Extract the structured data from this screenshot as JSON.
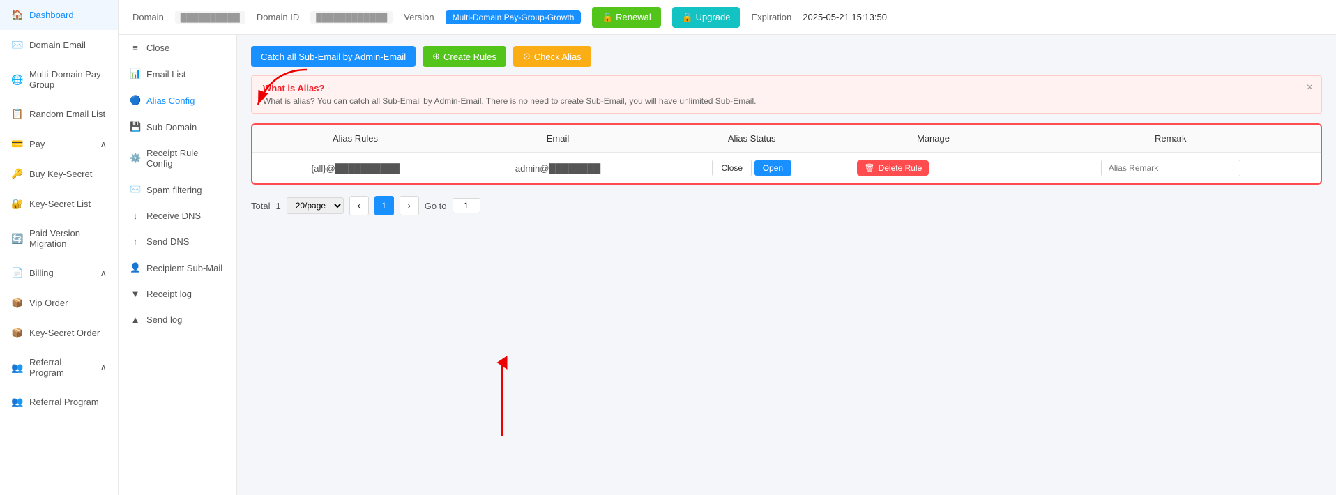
{
  "sidebar": {
    "items": [
      {
        "id": "dashboard",
        "label": "Dashboard",
        "icon": "🏠"
      },
      {
        "id": "domain-email",
        "label": "Domain Email",
        "icon": "✉️"
      },
      {
        "id": "multi-domain",
        "label": "Multi-Domain Pay-Group",
        "icon": "🌐"
      },
      {
        "id": "random-email",
        "label": "Random Email List",
        "icon": "📋"
      },
      {
        "id": "pay",
        "label": "Pay",
        "icon": "💳",
        "hasArrow": true,
        "expanded": true
      },
      {
        "id": "buy-key",
        "label": "Buy Key-Secret",
        "icon": "🔑"
      },
      {
        "id": "key-secret-list",
        "label": "Key-Secret List",
        "icon": "🔐"
      },
      {
        "id": "paid-migration",
        "label": "Paid Version Migration",
        "icon": "🔄"
      },
      {
        "id": "billing",
        "label": "Billing",
        "icon": "📄",
        "hasArrow": true,
        "expanded": true
      },
      {
        "id": "vip-order",
        "label": "Vip Order",
        "icon": "📦"
      },
      {
        "id": "key-secret-order",
        "label": "Key-Secret Order",
        "icon": "📦"
      },
      {
        "id": "referral-program",
        "label": "Referral Program",
        "icon": "👥",
        "hasArrow": true,
        "expanded": true
      },
      {
        "id": "referral-program-2",
        "label": "Referral Program",
        "icon": "👥"
      }
    ]
  },
  "header": {
    "domain_label": "Domain",
    "domain_value": "██████████",
    "domain_id_label": "Domain ID",
    "domain_id_value": "████████████",
    "version_label": "Version",
    "version_value": "Multi-Domain Pay-Group-Growth",
    "renewal_label": "🔒 Renewal",
    "upgrade_label": "🔒 Upgrade",
    "expiration_label": "Expiration",
    "expiration_value": "2025-05-21 15:13:50"
  },
  "sub_sidebar": {
    "items": [
      {
        "id": "close",
        "label": "Close",
        "icon": "≡"
      },
      {
        "id": "email-list",
        "label": "Email List",
        "icon": "📊"
      },
      {
        "id": "alias-config",
        "label": "Alias Config",
        "icon": "🔵",
        "active": true
      },
      {
        "id": "sub-domain",
        "label": "Sub-Domain",
        "icon": "💾"
      },
      {
        "id": "receipt-rule",
        "label": "Receipt Rule Config",
        "icon": "⚙️"
      },
      {
        "id": "spam-filtering",
        "label": "Spam filtering",
        "icon": "✉️"
      },
      {
        "id": "receive-dns",
        "label": "Receive DNS",
        "icon": "↓"
      },
      {
        "id": "send-dns",
        "label": "Send DNS",
        "icon": "↑"
      },
      {
        "id": "recipient-sub-mail",
        "label": "Recipient Sub-Mail",
        "icon": "👤"
      },
      {
        "id": "receipt-log",
        "label": "Receipt log",
        "icon": "▼"
      },
      {
        "id": "send-log",
        "label": "Send log",
        "icon": "▲"
      }
    ]
  },
  "toolbar": {
    "catch_all_label": "Catch all Sub-Email by Admin-Email",
    "create_rules_label": "Create Rules",
    "check_alias_label": "Check Alias"
  },
  "alert": {
    "title": "What is Alias?",
    "text": "What is alias? You can catch all Sub-Email by Admin-Email. There is no need to create Sub-Email, you will have unlimited Sub-Email."
  },
  "table": {
    "columns": [
      "Alias Rules",
      "Email",
      "Alias Status",
      "Manage",
      "Remark"
    ],
    "rows": [
      {
        "alias_rules": "{all}@██████████",
        "email": "admin@████████",
        "status_close": "Close",
        "status_open": "Open",
        "delete_label": "Delete Rule",
        "remark_placeholder": "Alias Remark"
      }
    ]
  },
  "pagination": {
    "total_label": "Total",
    "total_value": "1",
    "per_page": "20/page",
    "current_page": "1",
    "goto_label": "Go to",
    "goto_value": "1"
  }
}
